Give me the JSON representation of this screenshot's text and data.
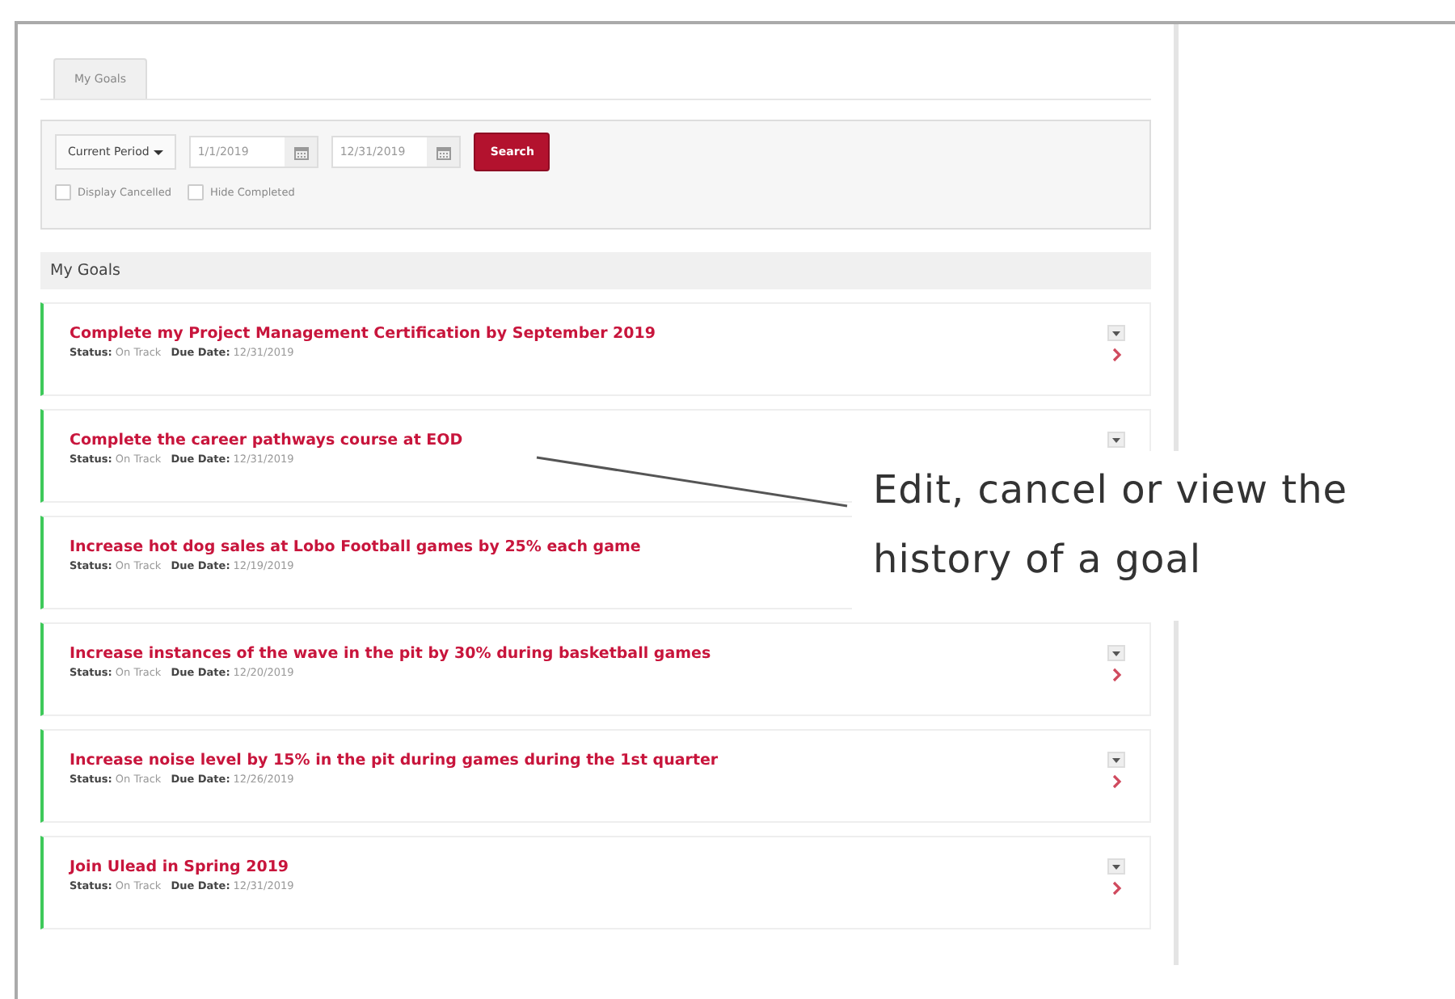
{
  "tabs": [
    {
      "label": "My Goals",
      "selected": true
    }
  ],
  "filters": {
    "period": "Current Period",
    "start_date": "1/1/2019",
    "end_date": "12/31/2019",
    "search": "Search",
    "checkboxes": [
      {
        "label": "Display Cancelled",
        "checked": false
      },
      {
        "label": "Hide Completed",
        "checked": false
      }
    ]
  },
  "section_title": "My Goals",
  "goals": [
    {
      "title": "Complete my Project Management Certification by September 2019",
      "status_label": "Status:",
      "status": "On Track",
      "due_label": "Due Date:",
      "due": "12/31/2019",
      "menu_button": true,
      "chevron": true
    },
    {
      "title": "Complete the career pathways course at EOD",
      "status_label": "Status:",
      "status": "On Track",
      "due_label": "Due Date:",
      "due": "12/31/2019",
      "menu_button": true,
      "chevron": false
    },
    {
      "title": "Increase hot dog sales at Lobo Football games by 25% each game",
      "status_label": "Status:",
      "status": "On Track",
      "due_label": "Due Date:",
      "due": "12/19/2019",
      "menu_button": false,
      "chevron": false
    },
    {
      "title": "Increase instances of the wave in the pit by 30% during basketball games",
      "status_label": "Status:",
      "status": "On Track",
      "due_label": "Due Date:",
      "due": "12/20/2019",
      "menu_button": true,
      "chevron": true
    },
    {
      "title": "Increase noise level by 15% in the pit during games during the 1st quarter",
      "status_label": "Status:",
      "status": "On Track",
      "due_label": "Due Date:",
      "due": "12/26/2019",
      "menu_button": true,
      "chevron": true
    },
    {
      "title": "Join Ulead in Spring 2019",
      "status_label": "Status:",
      "status": "On Track",
      "due_label": "Due Date:",
      "due": "12/31/2019",
      "menu_button": true,
      "chevron": true
    }
  ],
  "callout": {
    "text": "Edit, cancel or view the history of a goal"
  }
}
